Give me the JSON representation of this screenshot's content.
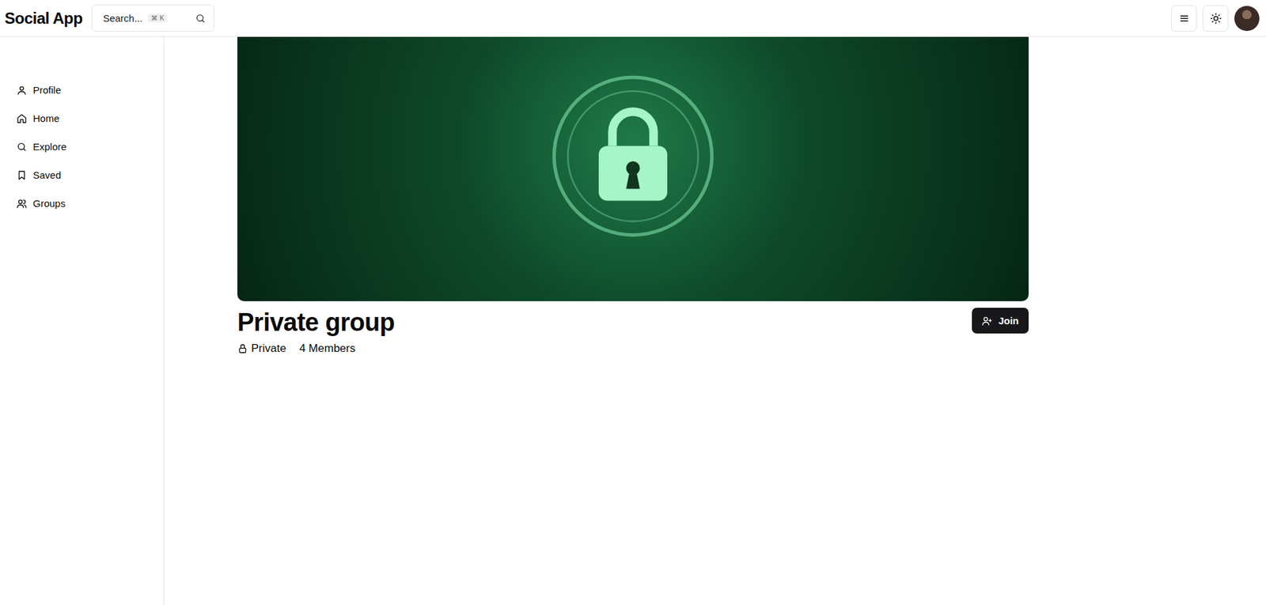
{
  "app": {
    "logo": "Social App"
  },
  "search": {
    "placeholder": "Search...",
    "shortcut": [
      "⌘",
      "K"
    ]
  },
  "sidebar": {
    "items": [
      {
        "label": "Profile",
        "icon": "user"
      },
      {
        "label": "Home",
        "icon": "home"
      },
      {
        "label": "Explore",
        "icon": "search"
      },
      {
        "label": "Saved",
        "icon": "bookmark"
      },
      {
        "label": "Groups",
        "icon": "users"
      }
    ]
  },
  "group": {
    "title": "Private group",
    "privacy": "Private",
    "members": "4 Members",
    "join_button": "Join"
  }
}
